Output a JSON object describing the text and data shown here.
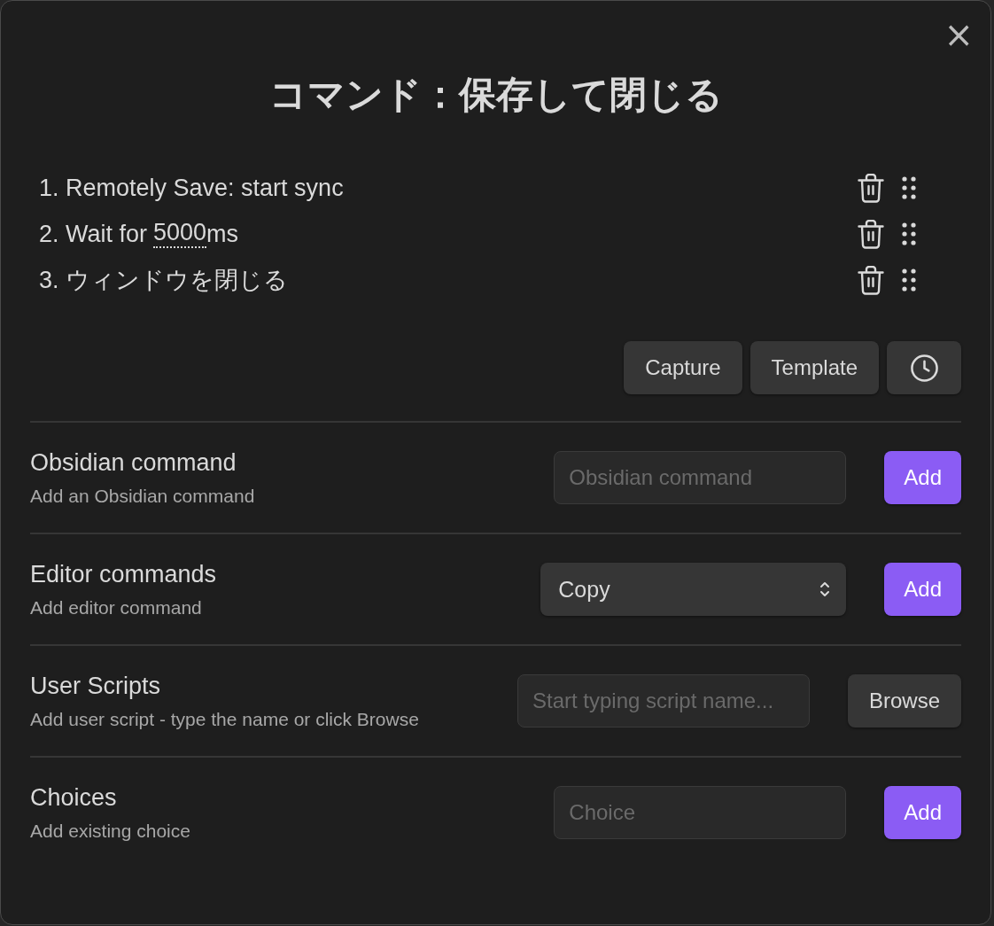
{
  "modal": {
    "close": "×",
    "title": "コマンド：保存して閉じる"
  },
  "commands": [
    {
      "kind": "command",
      "number": "1.",
      "label": "Remotely Save: start sync"
    },
    {
      "kind": "wait",
      "number": "2.",
      "prefix": "Wait for",
      "value": "5000",
      "suffix": "ms"
    },
    {
      "kind": "command",
      "number": "3.",
      "label": "ウィンドウを閉じる"
    }
  ],
  "actions": [
    {
      "kind": "text",
      "label": "Capture"
    },
    {
      "kind": "text",
      "label": "Template"
    },
    {
      "kind": "clock"
    }
  ],
  "settings": [
    {
      "kind": "input",
      "name": "Obsidian command",
      "description": "Add an Obsidian command",
      "placeholder": "Obsidian command",
      "button": "Add",
      "primary": true
    },
    {
      "kind": "select",
      "name": "Editor commands",
      "description": "Add editor command",
      "value": "Copy",
      "button": "Add",
      "primary": true
    },
    {
      "kind": "input",
      "name": "User Scripts",
      "description": "Add user script - type the name or click Browse",
      "placeholder": "Start typing script name...",
      "button": "Browse",
      "primary": false
    },
    {
      "kind": "input",
      "name": "Choices",
      "description": "Add existing choice",
      "placeholder": "Choice",
      "button": "Add",
      "primary": true
    }
  ]
}
